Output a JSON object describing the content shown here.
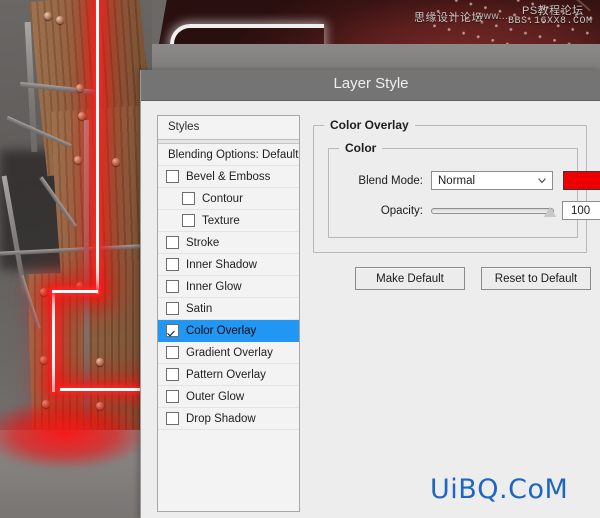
{
  "window": {
    "title": "Layer Style"
  },
  "watermarks": {
    "top_left_cn": "思缘设计论坛",
    "top_left_url": "www....",
    "top_right_cn": "PS教程论坛",
    "top_right_url": "BBS.16XX8.COM",
    "bottom_brand": "UiBQ.CoM"
  },
  "styles_panel": {
    "header": "Styles",
    "blending_options": "Blending Options: Default",
    "items": [
      {
        "label": "Bevel & Emboss",
        "checked": false,
        "indent": false,
        "selected": false
      },
      {
        "label": "Contour",
        "checked": false,
        "indent": true,
        "selected": false
      },
      {
        "label": "Texture",
        "checked": false,
        "indent": true,
        "selected": false
      },
      {
        "label": "Stroke",
        "checked": false,
        "indent": false,
        "selected": false
      },
      {
        "label": "Inner Shadow",
        "checked": false,
        "indent": false,
        "selected": false
      },
      {
        "label": "Inner Glow",
        "checked": false,
        "indent": false,
        "selected": false
      },
      {
        "label": "Satin",
        "checked": false,
        "indent": false,
        "selected": false
      },
      {
        "label": "Color Overlay",
        "checked": true,
        "indent": false,
        "selected": true
      },
      {
        "label": "Gradient Overlay",
        "checked": false,
        "indent": false,
        "selected": false
      },
      {
        "label": "Pattern Overlay",
        "checked": false,
        "indent": false,
        "selected": false
      },
      {
        "label": "Outer Glow",
        "checked": false,
        "indent": false,
        "selected": false
      },
      {
        "label": "Drop Shadow",
        "checked": false,
        "indent": false,
        "selected": false
      }
    ]
  },
  "color_overlay": {
    "group_title": "Color Overlay",
    "subgroup_title": "Color",
    "blend_mode_label": "Blend Mode:",
    "blend_mode_value": "Normal",
    "color_swatch_hex": "#ee0000",
    "opacity_label": "Opacity:",
    "opacity_value": "100",
    "opacity_unit": "%",
    "opacity_percent": 100
  },
  "buttons": {
    "make_default": "Make Default",
    "reset_to_default": "Reset to Default"
  }
}
